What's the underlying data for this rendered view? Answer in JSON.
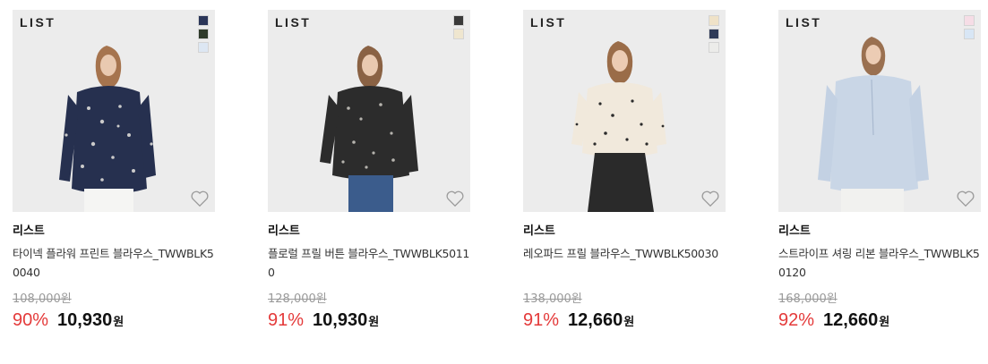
{
  "products": [
    {
      "logo": "LIST",
      "brand": "리스트",
      "title": "타이넥 플라워 프린트 블라우스_TWWBLK50040",
      "original_price": "108,000원",
      "discount": "90%",
      "sale_price": "10,930",
      "currency": "원",
      "swatches": [
        "#2a3558",
        "#2e3a2a",
        "#dde7f3"
      ],
      "icon": "heart-outline-icon",
      "image_desc": "navy floral blouse"
    },
    {
      "logo": "LIST",
      "brand": "리스트",
      "title": "플로럴 프릴 버튼 블라우스_TWWBLK50110",
      "original_price": "128,000원",
      "discount": "91%",
      "sale_price": "10,930",
      "currency": "원",
      "swatches": [
        "#3a3a3a",
        "#efe6cf"
      ],
      "icon": "heart-outline-icon",
      "image_desc": "black floral blouse"
    },
    {
      "logo": "LIST",
      "brand": "리스트",
      "title": "레오파드 프릴 블라우스_TWWBLK50030",
      "original_price": "138,000원",
      "discount": "91%",
      "sale_price": "12,660",
      "currency": "원",
      "swatches": [
        "#efe2c8",
        "#2f3b58",
        "#ececea"
      ],
      "icon": "heart-outline-icon",
      "image_desc": "cream leopard blouse"
    },
    {
      "logo": "LIST",
      "brand": "리스트",
      "title": "스트라이프 셔링 리본 블라우스_TWWBLK50120",
      "original_price": "168,000원",
      "discount": "92%",
      "sale_price": "12,660",
      "currency": "원",
      "swatches": [
        "#f6dde6",
        "#d8e6f5"
      ],
      "icon": "heart-outline-icon",
      "image_desc": "light blue stripe blouse"
    }
  ],
  "colors": {
    "discount": "#e43a3a",
    "thumb_bg": "#ececec",
    "orig_price": "#9a9a9a"
  }
}
